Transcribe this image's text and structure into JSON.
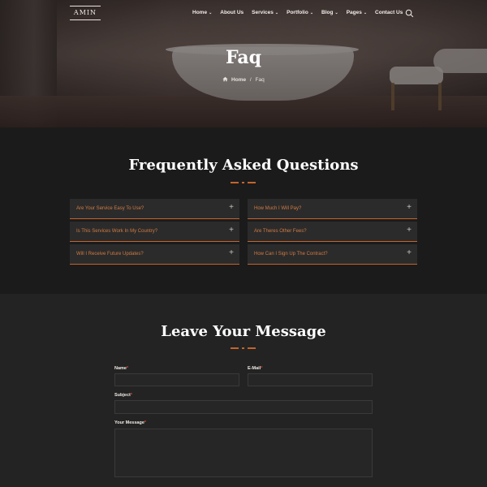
{
  "header": {
    "logo": "AMIN",
    "nav": [
      {
        "label": "Home",
        "has_dropdown": true
      },
      {
        "label": "About Us",
        "has_dropdown": false
      },
      {
        "label": "Services",
        "has_dropdown": true
      },
      {
        "label": "Portfolio",
        "has_dropdown": true
      },
      {
        "label": "Blog",
        "has_dropdown": true
      },
      {
        "label": "Pages",
        "has_dropdown": true
      },
      {
        "label": "Contact Us",
        "has_dropdown": false
      }
    ],
    "search_icon": "search-icon"
  },
  "hero": {
    "title": "Faq",
    "breadcrumb": {
      "home": "Home",
      "separator": "/",
      "current": "Faq"
    }
  },
  "faq": {
    "title": "Frequently Asked Questions",
    "accent_color": "#c4642c",
    "left": [
      "Are Your Service Easy To Use?",
      "Is This Services Work In My Country?",
      "Will I Receive Future Updates?"
    ],
    "right": [
      "How Much I Will Pay?",
      "Are Theres Other Fees?",
      "How Can I Sign Up The Contract?"
    ],
    "toggle_icon": "plus-icon"
  },
  "message": {
    "title": "Leave Your Message",
    "fields": {
      "name": {
        "label": "Name",
        "required": "*"
      },
      "email": {
        "label": "E-Mail",
        "required": "*"
      },
      "subject": {
        "label": "Subject",
        "required": "*"
      },
      "message": {
        "label": "Your Message",
        "required": "*"
      }
    }
  }
}
